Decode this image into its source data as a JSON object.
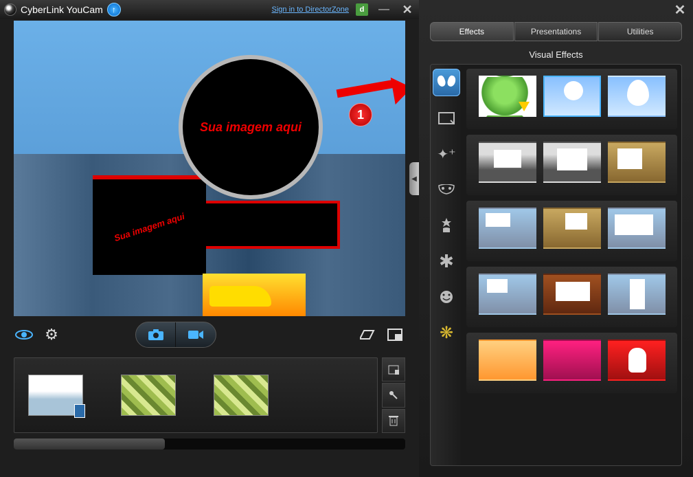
{
  "app": {
    "title": "CyberLink YouCam",
    "signin_text": "Sign in to DirectorZone",
    "dz_icon_label": "d"
  },
  "preview": {
    "overlay_text_1": "Sua imagem aqui",
    "overlay_text_2": "Sua imagem aqui",
    "annotation_badge": "1"
  },
  "right": {
    "tabs": [
      {
        "label": "Effects"
      },
      {
        "label": "Presentations"
      },
      {
        "label": "Utilities"
      }
    ],
    "active_tab": 0,
    "section_title": "Visual Effects",
    "categories": [
      {
        "name": "scenes",
        "icon": "butterfly"
      },
      {
        "name": "frames",
        "icon": "frame"
      },
      {
        "name": "filters",
        "icon": "wand"
      },
      {
        "name": "distortions",
        "icon": "mask"
      },
      {
        "name": "emotions",
        "icon": "star-person"
      },
      {
        "name": "gadgets",
        "icon": "splat"
      },
      {
        "name": "avatars",
        "icon": "smiley"
      },
      {
        "name": "particles",
        "icon": "flower"
      }
    ],
    "active_category": 0
  },
  "icons": {
    "upload": "↑",
    "minimize": "—",
    "close": "✕",
    "eye": "👁",
    "gear": "⚙",
    "camera": "📷",
    "video": "■",
    "erase": "◢",
    "pip": "⧉",
    "photo_import": "🖼",
    "pin": "📌",
    "trash": "🗑",
    "expand": "◀",
    "frame": "▭",
    "wand": "✦",
    "mask": "◐",
    "star": "✿",
    "splat": "✱",
    "smiley": "☺",
    "flower": "❋"
  }
}
